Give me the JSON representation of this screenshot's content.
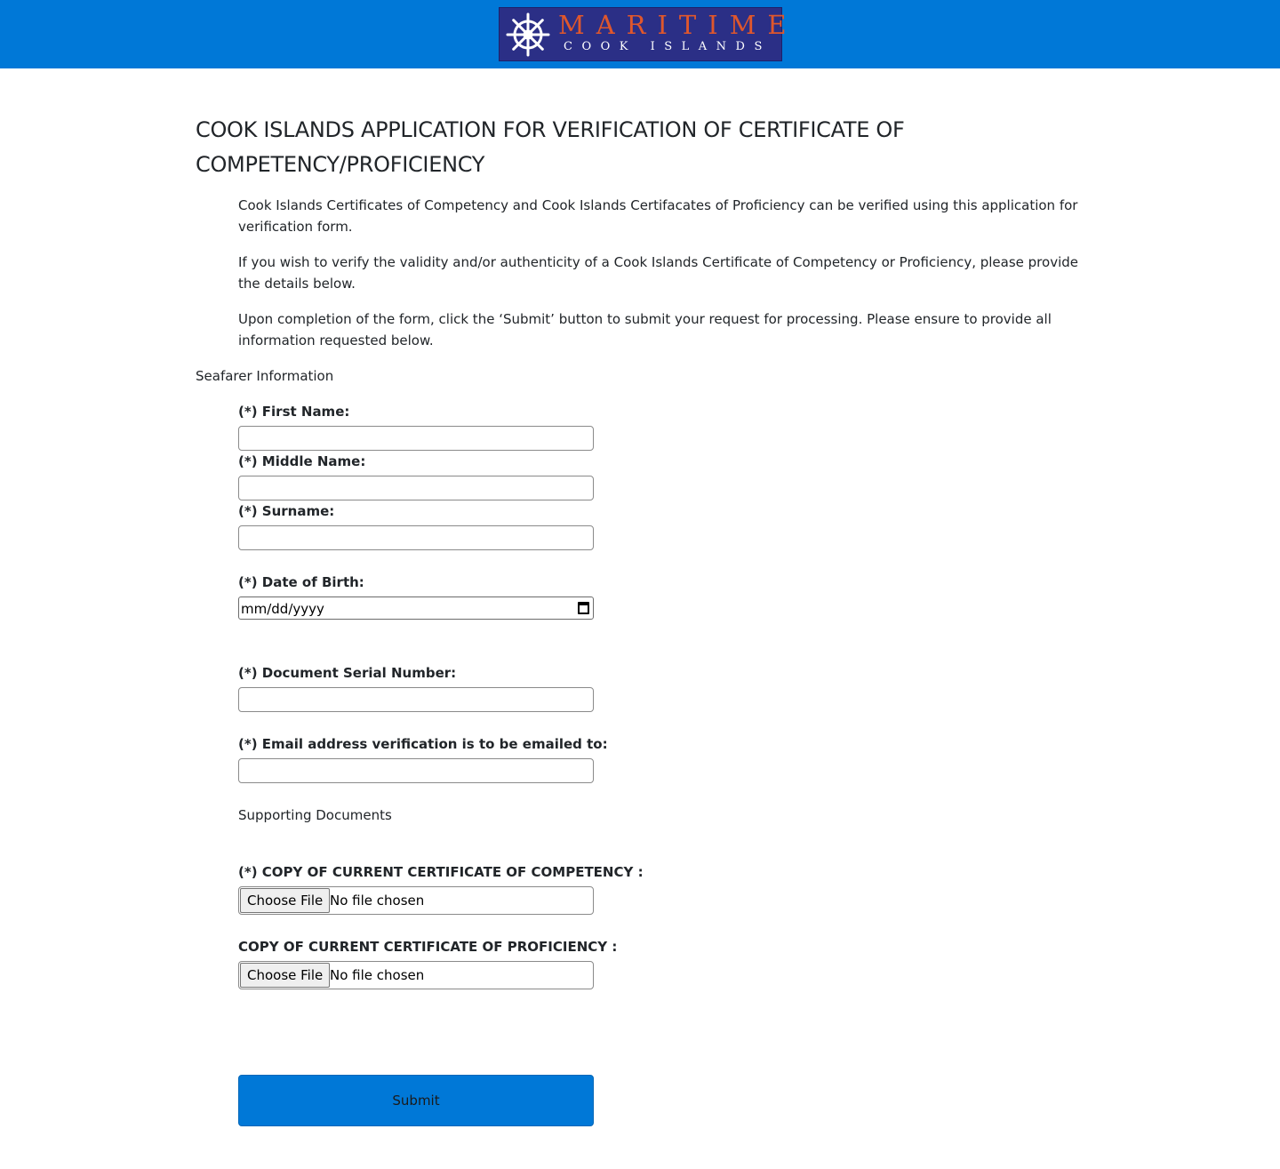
{
  "header": {
    "logo_word": "MARITIME",
    "logo_sub": "COOK ISLANDS",
    "logo_icon": "ship-wheel-icon",
    "bar_color": "#0078d7",
    "logo_bg": "#2b2f86",
    "logo_accent": "#e0572c"
  },
  "page": {
    "title": "COOK ISLANDS APPLICATION FOR VERIFICATION OF CERTIFICATE OF COMPETENCY/PROFICIENCY",
    "intro": [
      "Cook Islands Certificates of Competency and Cook Islands Certifacates of Proficiency can be verified using this application for verification form.",
      "If you wish to verify the validity and/or authenticity of a Cook Islands Certificate of Competency or Proficiency, please provide the details below.",
      "Upon completion of the form, click the ‘Submit’ button to submit your request for processing. Please ensure to provide all information requested below."
    ]
  },
  "form": {
    "seafarer_heading": "Seafarer Information",
    "first_name": {
      "label": "(*) First Name:",
      "value": ""
    },
    "middle_name": {
      "label": "(*) Middle Name:",
      "value": ""
    },
    "surname": {
      "label": "(*) Surname:",
      "value": ""
    },
    "dob": {
      "label": "(*) Date of Birth:",
      "placeholder": "mm/dd/yyyy"
    },
    "serial": {
      "label": "(*) Document Serial Number:",
      "value": ""
    },
    "email": {
      "label": "(*) Email address verification is to be emailed to:",
      "value": ""
    },
    "supporting_heading": "Supporting Documents",
    "competency_file": {
      "label": "(*) COPY OF CURRENT CERTIFICATE OF COMPETENCY :",
      "button": "Choose File",
      "status": "No file chosen"
    },
    "proficiency_file": {
      "label": "COPY OF CURRENT CERTIFICATE OF PROFICIENCY :",
      "button": "Choose File",
      "status": "No file chosen"
    },
    "submit_label": "Submit",
    "submit_color": "#0078d7"
  }
}
